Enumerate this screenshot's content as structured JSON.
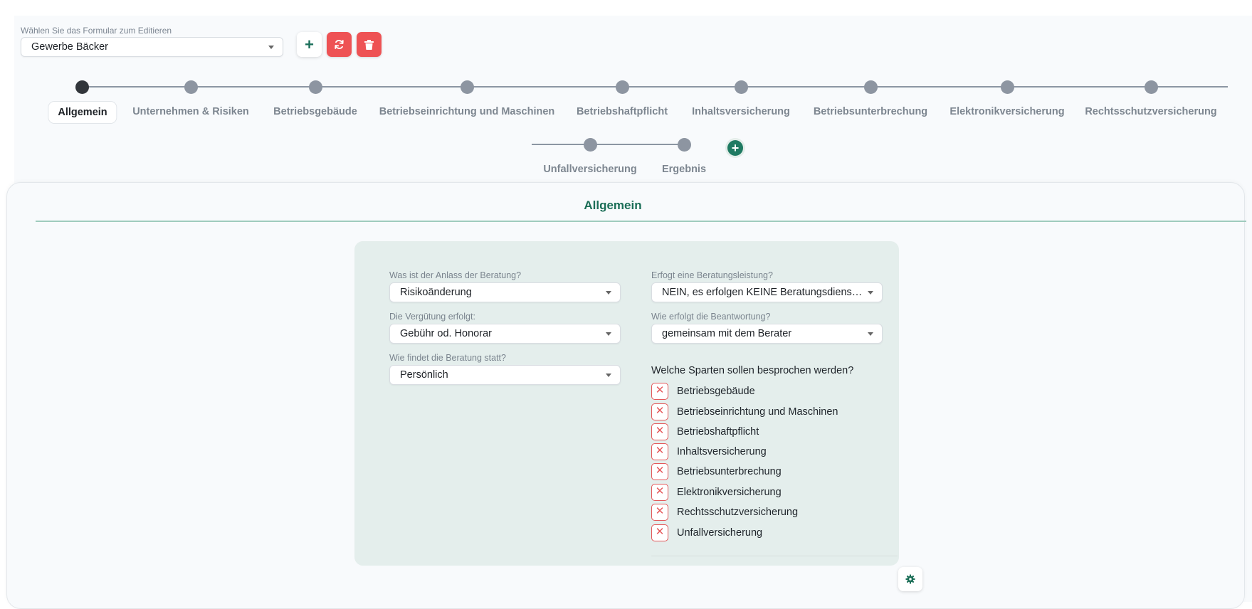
{
  "form_picker": {
    "label": "Wählen Sie das Formular zum Editieren",
    "value": "Gewerbe Bäcker"
  },
  "actions": {
    "add_symbol": "+"
  },
  "colors": {
    "accent": "#1b6e57",
    "danger": "#ee5254",
    "step_active": "#32363b",
    "step_inactive": "#8d95a1"
  },
  "steps": [
    {
      "label": "Allgemein",
      "active": true
    },
    {
      "label": "Unternehmen & Risiken"
    },
    {
      "label": "Betriebsgebäude"
    },
    {
      "label": "Betriebseinrichtung und Maschinen"
    },
    {
      "label": "Betriebshaftpflicht"
    },
    {
      "label": "Inhaltsversicherung"
    },
    {
      "label": "Betriebsunterbrechung"
    },
    {
      "label": "Elektronikversicherung"
    },
    {
      "label": "Rechtsschutzversicherung"
    },
    {
      "label": "Unfallversicherung"
    },
    {
      "label": "Ergebnis"
    }
  ],
  "section": {
    "title": "Allgemein"
  },
  "fields": {
    "anlass": {
      "label": "Was ist der Anlass der Beratung?",
      "value": "Risikoänderung"
    },
    "verguetung": {
      "label": "Die Vergütung erfolgt:",
      "value": "Gebühr od. Honorar"
    },
    "ort": {
      "label": "Wie findet die Beratung statt?",
      "value": "Persönlich"
    },
    "leistung": {
      "label": "Erfogt eine Beratungsleistung?",
      "value": "NEIN, es erfolgen KEINE Beratungsdienstleistungen"
    },
    "beantwortung": {
      "label": "Wie erfolgt die Beantwortung?",
      "value": "gemeinsam mit dem Berater"
    }
  },
  "sparten": {
    "question": "Welche Sparten sollen besprochen werden?",
    "check_symbol": "✕",
    "items": [
      "Betriebsgebäude",
      "Betriebseinrichtung und Maschinen",
      "Betriebshaftpflicht",
      "Inhaltsversicherung",
      "Betriebsunterbrechung",
      "Elektronikversicherung",
      "Rechtsschutzversicherung",
      "Unfallversicherung"
    ]
  },
  "icons": {
    "add": "plus-icon",
    "refresh": "refresh-icon",
    "delete": "trash-icon",
    "settings": "gear-icon",
    "checkbox": "x-icon",
    "dropdown": "caret-down-icon"
  }
}
